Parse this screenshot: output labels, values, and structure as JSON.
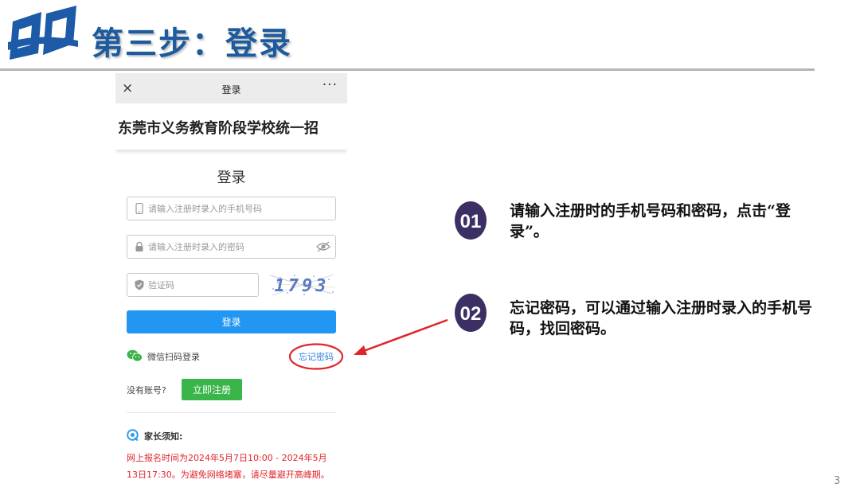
{
  "slide": {
    "title": "第三步：登录",
    "page_number": "3",
    "colors": {
      "title": "#1d5a9e",
      "logo": "#1d5aa8",
      "badge": "#3c2f63",
      "annotation": "#e0242b"
    }
  },
  "phone": {
    "topbar": {
      "close_icon": "×",
      "title": "登录",
      "more_icon": "···"
    },
    "site_name": "东莞市义务教育阶段学校统一招",
    "form": {
      "title": "登录",
      "phone_placeholder": "请输入注册时录入的手机号码",
      "password_placeholder": "请输入注册时录入的密码",
      "code_placeholder": "验证码",
      "captcha_text": "1793",
      "login_button": "登录",
      "wechat_login": "微信扫码登录",
      "forgot_password": "忘记密码",
      "no_account": "没有账号?",
      "register_button": "立即注册"
    },
    "notice": {
      "title": "家长须知:",
      "text": "网上报名时间为2024年5月7日10:00 - 2024年5月13日17:30。为避免网络堵塞，请尽量避开高峰期。"
    }
  },
  "steps": [
    {
      "badge": "01",
      "text": "请输入注册时的手机号码和密码，点击“登录”。"
    },
    {
      "badge": "02",
      "text": "忘记密码，可以通过输入注册时录入的手机号码，找回密码。"
    }
  ]
}
